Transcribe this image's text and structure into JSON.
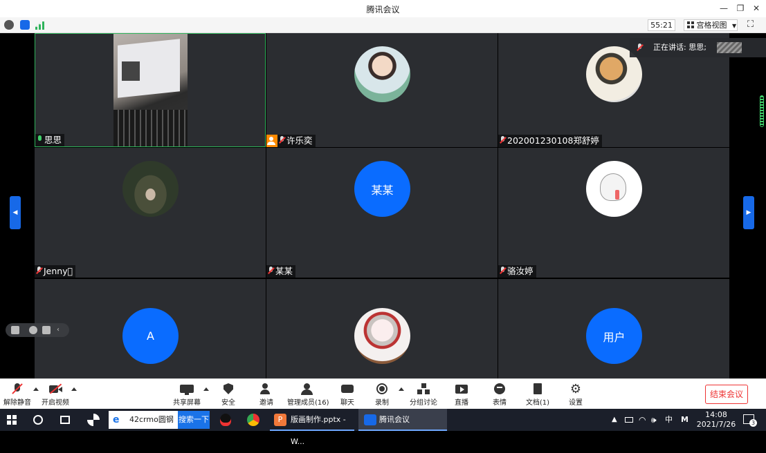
{
  "window": {
    "title": "腾讯会议"
  },
  "topbar": {
    "timer": "55:21",
    "view_label": "宫格视图"
  },
  "speaking": {
    "label": "正在讲话: 思思;"
  },
  "tiles": [
    {
      "name": "思思"
    },
    {
      "name": "许乐奕"
    },
    {
      "name": "202001230108郑舒婷"
    },
    {
      "name": "Jenny\u0000"
    },
    {
      "name": "某某",
      "avatar_text": "某某"
    },
    {
      "name": "骆汝婷"
    },
    {
      "avatar_text": "A"
    },
    {},
    {
      "avatar_text": "用户"
    }
  ],
  "bottombar": {
    "unmute": "解除静音",
    "start_video": "开启视频",
    "share_screen": "共享屏幕",
    "security": "安全",
    "invite": "邀请",
    "members": "管理成员(16)",
    "chat": "聊天",
    "record": "录制",
    "breakout": "分组讨论",
    "live": "直播",
    "reactions": "表情",
    "docs": "文档(1)",
    "settings": "设置",
    "end_meeting": "结束会议"
  },
  "taskbar": {
    "search_value": "42crmo圆钢",
    "search_button": "搜索一下",
    "app_ppt": "版画制作.pptx - W...",
    "app_meeting": "腾讯会议",
    "ime_lang": "中",
    "ime_mode": "M",
    "time": "14:08",
    "date": "2021/7/26",
    "notification_count": "3"
  },
  "colors": {
    "accent": "#0a6cff",
    "danger": "#e33333",
    "active_border": "#2fb35a"
  }
}
